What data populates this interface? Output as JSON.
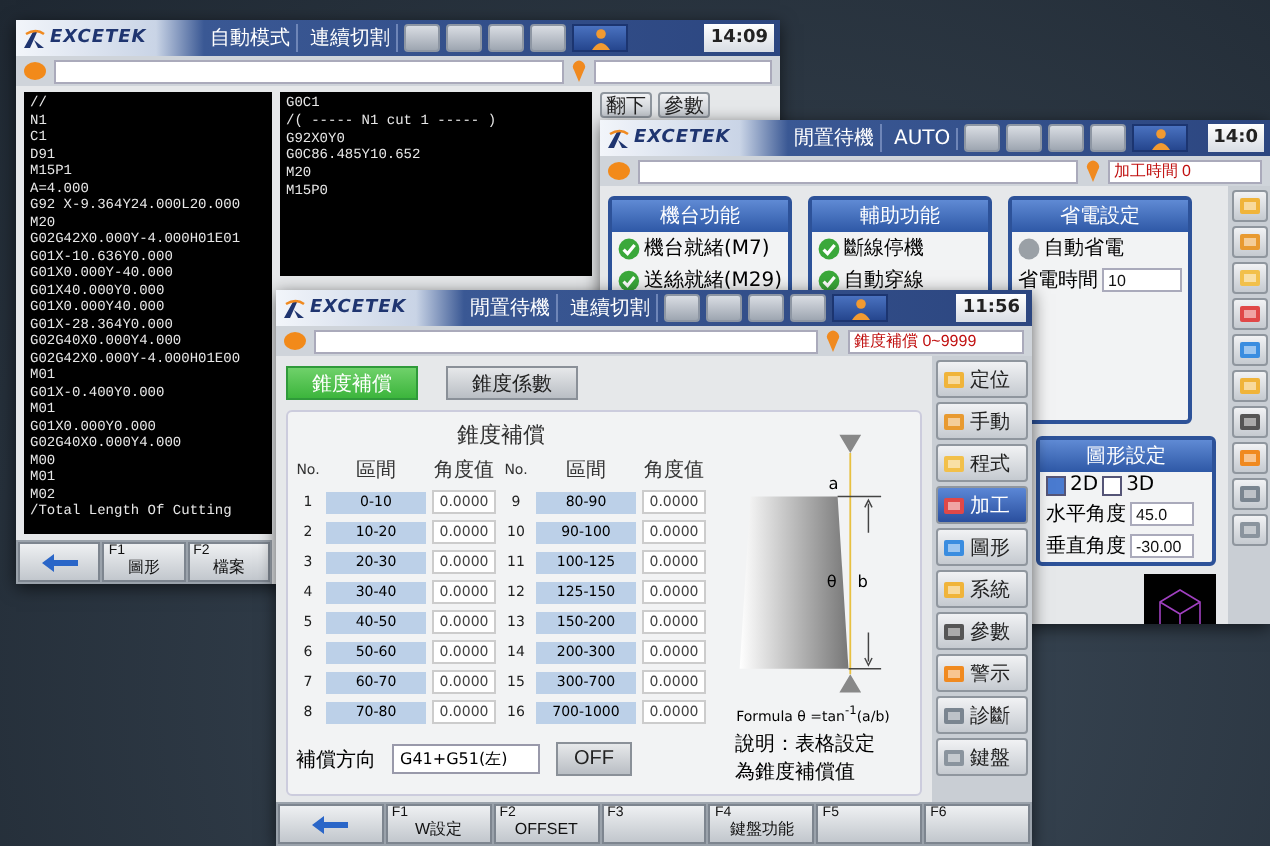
{
  "back_window": {
    "logo": "EXCETEK",
    "modes": [
      "自動模式",
      "連續切割"
    ],
    "clock": "14:09",
    "page_button": "翻下",
    "side_button": "參數",
    "left_code": [
      "//",
      "N1",
      "C1",
      "D91",
      "M15P1",
      "A=4.000",
      "G92 X-9.364Y24.000L20.000",
      "M20",
      "G02G42X0.000Y-4.000H01E01",
      "G01X-10.636Y0.000",
      "G01X0.000Y-40.000",
      "G01X40.000Y0.000",
      "G01X0.000Y40.000",
      "G01X-28.364Y0.000",
      "G02G40X0.000Y4.000",
      "G02G42X0.000Y-4.000H01E00",
      "M01",
      "G01X-0.400Y0.000",
      "M01",
      "G01X0.000Y0.000",
      "G02G40X0.000Y4.000",
      "M00",
      "M01",
      "M02",
      "/Total Length Of Cutting"
    ],
    "right_code": [
      "G0C1",
      "/( ----- N1 cut 1 ----- )",
      "G92X0Y0",
      "G0C86.485Y10.652",
      "M20",
      "M15P0"
    ],
    "footer_keys": [
      {
        "key": "F1",
        "label": "圖形"
      },
      {
        "key": "F2",
        "label": "檔案"
      }
    ]
  },
  "middle_window": {
    "logo": "EXCETEK",
    "modes": [
      "閒置待機",
      "AUTO"
    ],
    "clock": "14:0",
    "status": "加工時間 0",
    "panels": [
      {
        "title": "機台功能",
        "items": [
          {
            "label": "機台就緒(M7)",
            "checked": true
          },
          {
            "label": "送絲就緒(M29)",
            "checked": true
          }
        ]
      },
      {
        "title": "輔助功能",
        "items": [
          {
            "label": "斷線停機",
            "checked": true
          },
          {
            "label": "自動穿線",
            "checked": true
          }
        ]
      }
    ],
    "power": {
      "title": "省電設定",
      "toggle": {
        "label": "自動省電",
        "on": false
      },
      "field_label": "省電時間",
      "field_value": "10"
    },
    "view": {
      "title": "圖形設定",
      "options": [
        {
          "label": "2D",
          "selected": true
        },
        {
          "label": "3D",
          "selected": false
        }
      ],
      "fields": [
        {
          "label": "水平角度",
          "value": "45.0"
        },
        {
          "label": "垂直角度",
          "value": "-30.00"
        }
      ]
    }
  },
  "front_window": {
    "logo": "EXCETEK",
    "modes": [
      "閒置待機",
      "連續切割"
    ],
    "clock": "11:56",
    "status": "錐度補償 0~9999",
    "tabs": [
      {
        "label": "錐度補償",
        "selected": true
      },
      {
        "label": "錐度係數",
        "selected": false
      }
    ],
    "title": "錐度補償",
    "columns": [
      "No.",
      "區間",
      "角度值",
      "No.",
      "區間",
      "角度值"
    ],
    "rows": [
      {
        "no": "1",
        "range": "0-10",
        "value": "0.0000"
      },
      {
        "no": "2",
        "range": "10-20",
        "value": "0.0000"
      },
      {
        "no": "3",
        "range": "20-30",
        "value": "0.0000"
      },
      {
        "no": "4",
        "range": "30-40",
        "value": "0.0000"
      },
      {
        "no": "5",
        "range": "40-50",
        "value": "0.0000"
      },
      {
        "no": "6",
        "range": "50-60",
        "value": "0.0000"
      },
      {
        "no": "7",
        "range": "60-70",
        "value": "0.0000"
      },
      {
        "no": "8",
        "range": "70-80",
        "value": "0.0000"
      },
      {
        "no": "9",
        "range": "80-90",
        "value": "0.0000"
      },
      {
        "no": "10",
        "range": "90-100",
        "value": "0.0000"
      },
      {
        "no": "11",
        "range": "100-125",
        "value": "0.0000"
      },
      {
        "no": "12",
        "range": "125-150",
        "value": "0.0000"
      },
      {
        "no": "13",
        "range": "150-200",
        "value": "0.0000"
      },
      {
        "no": "14",
        "range": "200-300",
        "value": "0.0000"
      },
      {
        "no": "15",
        "range": "300-700",
        "value": "0.0000"
      },
      {
        "no": "16",
        "range": "700-1000",
        "value": "0.0000"
      }
    ],
    "direction_label": "補償方向",
    "direction_value": "G41+G51(左)",
    "off_button": "OFF",
    "diagram_labels": {
      "a": "a",
      "b": "b",
      "theta": "θ"
    },
    "formula": "Formula θ =tan$^{-1}$(a/b)",
    "note": "說明：表格設定為錐度補償值",
    "side_buttons": [
      {
        "label": "定位",
        "selected": false
      },
      {
        "label": "手動",
        "selected": false
      },
      {
        "label": "程式",
        "selected": false
      },
      {
        "label": "加工",
        "selected": true
      },
      {
        "label": "圖形",
        "selected": false
      },
      {
        "label": "系統",
        "selected": false
      },
      {
        "label": "參數",
        "selected": false
      },
      {
        "label": "警示",
        "selected": false
      },
      {
        "label": "診斷",
        "selected": false
      },
      {
        "label": "鍵盤",
        "selected": false
      }
    ],
    "footer_keys": [
      {
        "key": "F1",
        "label": "W設定"
      },
      {
        "key": "F2",
        "label": "OFFSET"
      },
      {
        "key": "F3"
      },
      {
        "key": "F4",
        "label": "鍵盤功能"
      },
      {
        "key": "F5"
      },
      {
        "key": "F6"
      }
    ]
  }
}
